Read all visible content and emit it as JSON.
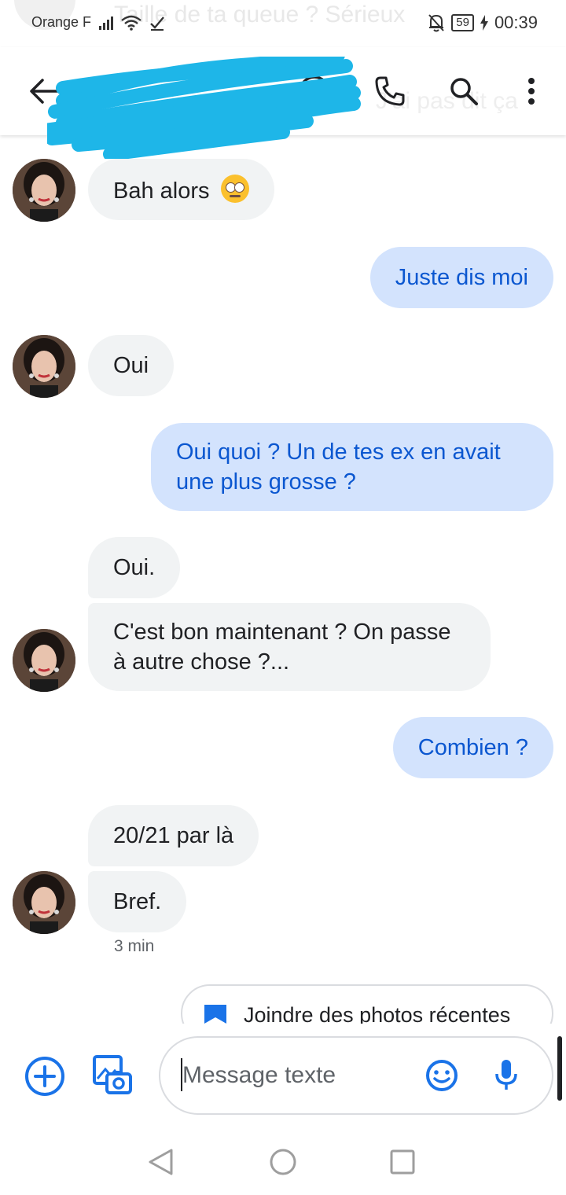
{
  "status_bar": {
    "carrier": "Orange F",
    "battery": "59",
    "time": "00:39"
  },
  "background_text": {
    "behind_status": "Taille de ta queue ? Sérieux",
    "behind_header": "J'ai pas dit ça"
  },
  "app_bar": {
    "contact_name": "",
    "icons": [
      "back-arrow-icon",
      "video-call-icon",
      "phone-icon",
      "search-icon",
      "more-vert-icon"
    ]
  },
  "messages": [
    {
      "direction": "incoming",
      "text": "Bah alors",
      "emoji": "rolling-eyes-emoji"
    },
    {
      "direction": "outgoing",
      "text": "Juste dis moi"
    },
    {
      "direction": "incoming",
      "text": "Oui"
    },
    {
      "direction": "outgoing",
      "text": "Oui quoi ? Un de tes ex en avait une plus grosse ?"
    },
    {
      "direction": "incoming",
      "text": "Oui."
    },
    {
      "direction": "incoming",
      "text": "C'est bon maintenant ? On passe à autre chose ?..."
    },
    {
      "direction": "outgoing",
      "text": "Combien ?"
    },
    {
      "direction": "incoming",
      "text": "20/21 par là"
    },
    {
      "direction": "incoming",
      "text": "Bref."
    }
  ],
  "timestamp": "3 min",
  "suggestion_chip": {
    "label": "Joindre des photos récentes",
    "icon": "photo-album-icon"
  },
  "composer": {
    "placeholder": "Message texte",
    "value": ""
  },
  "colors": {
    "accent": "#1a73e8",
    "outgoing_bubble": "#d3e3fd",
    "outgoing_text": "#0b57d0",
    "incoming_bubble": "#f1f3f4",
    "redaction_scribble": "#1eb6e8"
  }
}
